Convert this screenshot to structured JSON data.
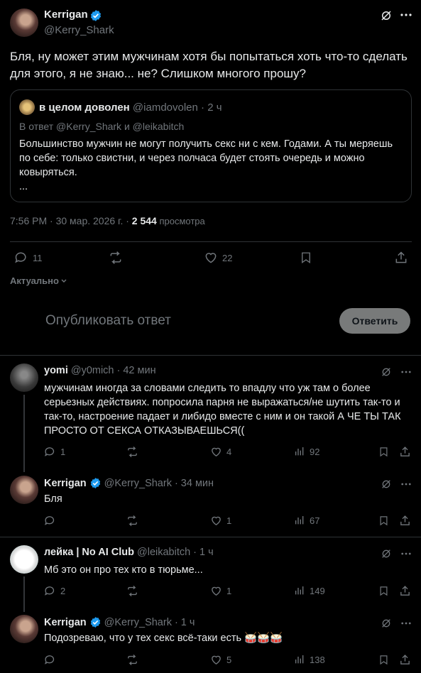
{
  "main_tweet": {
    "author_name": "Kerrigan",
    "author_handle": "@Kerry_Shark",
    "text": "Бля, ну может этим мужчинам хотя бы попытаться хоть что-то сделать для этого, я не знаю... не? Слишком многого прошу?",
    "quote": {
      "author_name": "в целом доволен",
      "author_handle": "@iamdovolen",
      "time": "· 2 ч",
      "reply_to_prefix": "В ответ ",
      "reply_to_1": "@Kerry_Shark",
      "reply_to_and": " и ",
      "reply_to_2": "@leikabitch",
      "text": "Большинство мужчин не могут получить секс ни с кем. Годами. А ты меряешь по себе: только свистни, и через полчаса будет стоять очередь и можно ковыряться.",
      "more": "..."
    },
    "timestamp": "7:56 PM · 30 мар. 2026 г. · ",
    "views_count": "2 544",
    "views_label": " просмотра",
    "replies": "11",
    "reposts": "",
    "likes": "22"
  },
  "sort": {
    "label": "Актуально"
  },
  "composer": {
    "placeholder": "Опубликовать ответ",
    "button": "Ответить"
  },
  "replies": [
    {
      "name": "yomi",
      "handle": "@y0mich",
      "time": "· 42 мин",
      "text": "мужчинам иногда за словами следить то впадлу что уж там о более серьезных действиях. попросила парня не выражаться/не шутить так-то и так-то, настроение падает и либидо вместе с ним и он такой А ЧЕ ТЫ ТАК ПРОСТО ОТ СЕКСА ОТКАЗЫВАЕШЬСЯ((",
      "replies": "1",
      "reposts": "",
      "likes": "4",
      "views": "92"
    },
    {
      "name": "Kerrigan",
      "handle": "@Kerry_Shark",
      "time": "· 34 мин",
      "text": "Бля",
      "replies": "",
      "reposts": "",
      "likes": "1",
      "views": "67"
    },
    {
      "name": "лейка | No AI Club",
      "handle": "@leikabitch",
      "time": "· 1 ч",
      "text": "Мб это он про тех кто в тюрьме...",
      "replies": "2",
      "reposts": "",
      "likes": "1",
      "views": "149"
    },
    {
      "name": "Kerrigan",
      "handle": "@Kerry_Shark",
      "time": "· 1 ч",
      "text": "Подозреваю, что у тех секс всё-таки есть 🥁🥁🥁",
      "replies": "",
      "reposts": "",
      "likes": "5",
      "views": "138"
    }
  ],
  "colors": {
    "accent": "#1d9bf0",
    "muted": "#71767b",
    "border": "#2f3336"
  }
}
